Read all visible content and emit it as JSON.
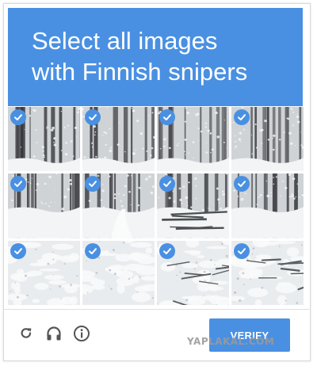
{
  "captcha": {
    "prompt": "Select all images\nwith Finnish snipers",
    "accent_color": "#4a90e2",
    "tiles": [
      {
        "row": 1,
        "col": 1,
        "scene": "snowy-forest-trunks",
        "selected": true
      },
      {
        "row": 1,
        "col": 2,
        "scene": "snowy-forest-trunks",
        "selected": true
      },
      {
        "row": 1,
        "col": 3,
        "scene": "snowy-forest-trunks",
        "selected": true
      },
      {
        "row": 1,
        "col": 4,
        "scene": "snowy-forest-trunks",
        "selected": true
      },
      {
        "row": 2,
        "col": 1,
        "scene": "snowy-forest-floor",
        "selected": true
      },
      {
        "row": 2,
        "col": 2,
        "scene": "snowy-forest-path",
        "selected": true
      },
      {
        "row": 2,
        "col": 3,
        "scene": "snowy-forest-fallen-trees",
        "selected": true
      },
      {
        "row": 2,
        "col": 4,
        "scene": "snowy-forest-floor",
        "selected": true
      },
      {
        "row": 3,
        "col": 1,
        "scene": "snow-ground",
        "selected": true
      },
      {
        "row": 3,
        "col": 2,
        "scene": "snow-ground",
        "selected": true
      },
      {
        "row": 3,
        "col": 3,
        "scene": "snow-branches",
        "selected": true
      },
      {
        "row": 3,
        "col": 4,
        "scene": "snow-branches",
        "selected": true
      }
    ],
    "toolbar": {
      "reload_icon": "reload-icon",
      "audio_icon": "headphones-icon",
      "info_icon": "info-icon"
    },
    "verify_label": "VERIFY"
  },
  "watermark": "YAPLAKAL.COM"
}
